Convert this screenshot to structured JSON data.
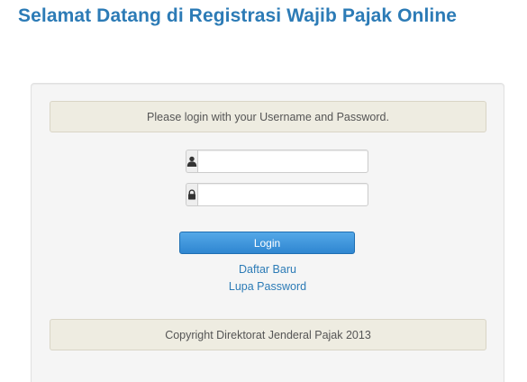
{
  "header": {
    "title": "Selamat Datang di Registrasi Wajib Pajak Online"
  },
  "login_panel": {
    "instruction": "Please login with your Username and Password.",
    "username": {
      "icon": "user-icon",
      "value": "",
      "placeholder": ""
    },
    "password": {
      "icon": "lock-icon",
      "value": "",
      "placeholder": ""
    },
    "login_label": "Login",
    "links": {
      "register": "Daftar Baru",
      "forgot_password": "Lupa Password"
    },
    "footer": "Copyright Direktorat Jenderal Pajak 2013"
  },
  "colors": {
    "title": "#2c7bb6",
    "link": "#2c7bb6",
    "button": "#3a8fd8",
    "notice_bg": "#eeece1",
    "panel_bg": "#f5f5f5"
  }
}
